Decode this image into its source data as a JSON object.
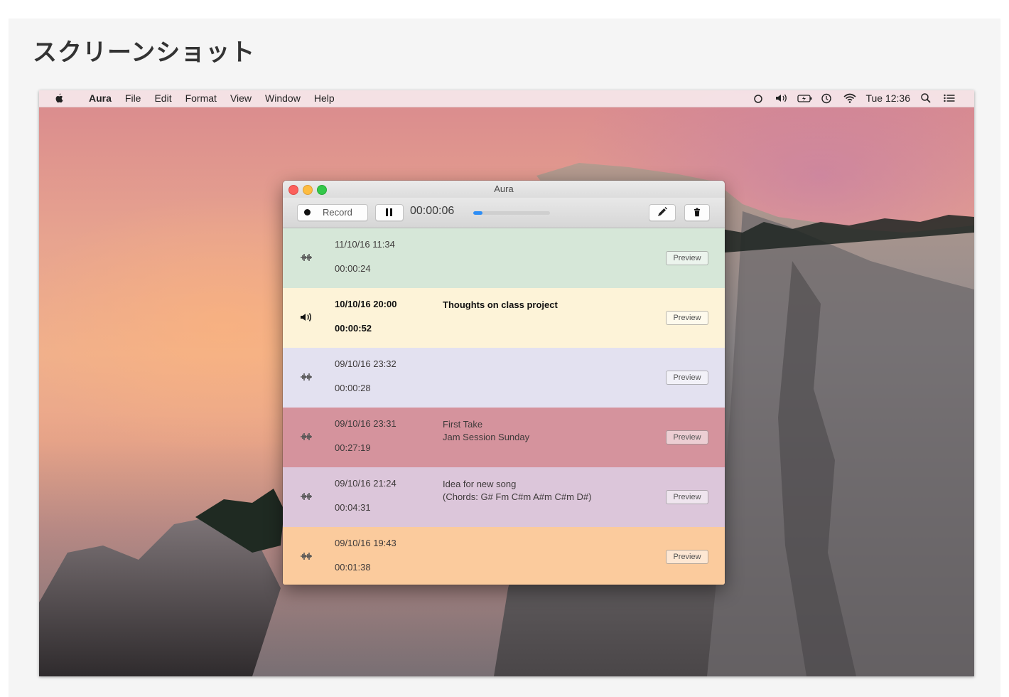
{
  "heading": "スクリーンショット",
  "menubar": {
    "app_name": "Aura",
    "items": [
      "File",
      "Edit",
      "Format",
      "View",
      "Window",
      "Help"
    ],
    "clock": "Tue 12:36"
  },
  "window": {
    "title": "Aura",
    "record_label": "Record",
    "timer": "00:00:06",
    "progress_fraction": 0.12
  },
  "recordings": [
    {
      "date": "11/10/16 11:34",
      "duration": "00:00:24",
      "note_line1": "",
      "note_line2": "",
      "preview_label": "Preview",
      "color": "#d6e7d8",
      "playing": false
    },
    {
      "date": "10/10/16 20:00",
      "duration": "00:00:52",
      "note_line1": "Thoughts on class project",
      "note_line2": "",
      "preview_label": "Preview",
      "color": "#fdf3d8",
      "playing": true
    },
    {
      "date": "09/10/16 23:32",
      "duration": "00:00:28",
      "note_line1": "",
      "note_line2": "",
      "preview_label": "Preview",
      "color": "#e3e1f0",
      "playing": false
    },
    {
      "date": "09/10/16 23:31",
      "duration": "00:27:19",
      "note_line1": "First Take",
      "note_line2": "Jam Session Sunday",
      "preview_label": "Preview",
      "color": "#d5939d",
      "playing": false
    },
    {
      "date": "09/10/16 21:24",
      "duration": "00:04:31",
      "note_line1": "Idea for new song",
      "note_line2": "(Chords: G# Fm C#m A#m C#m D#)",
      "preview_label": "Preview",
      "color": "#dcc6da",
      "playing": false
    },
    {
      "date": "09/10/16 19:43",
      "duration": "00:01:38",
      "note_line1": "",
      "note_line2": "",
      "preview_label": "Preview",
      "color": "#fbcb9d",
      "playing": false
    }
  ]
}
